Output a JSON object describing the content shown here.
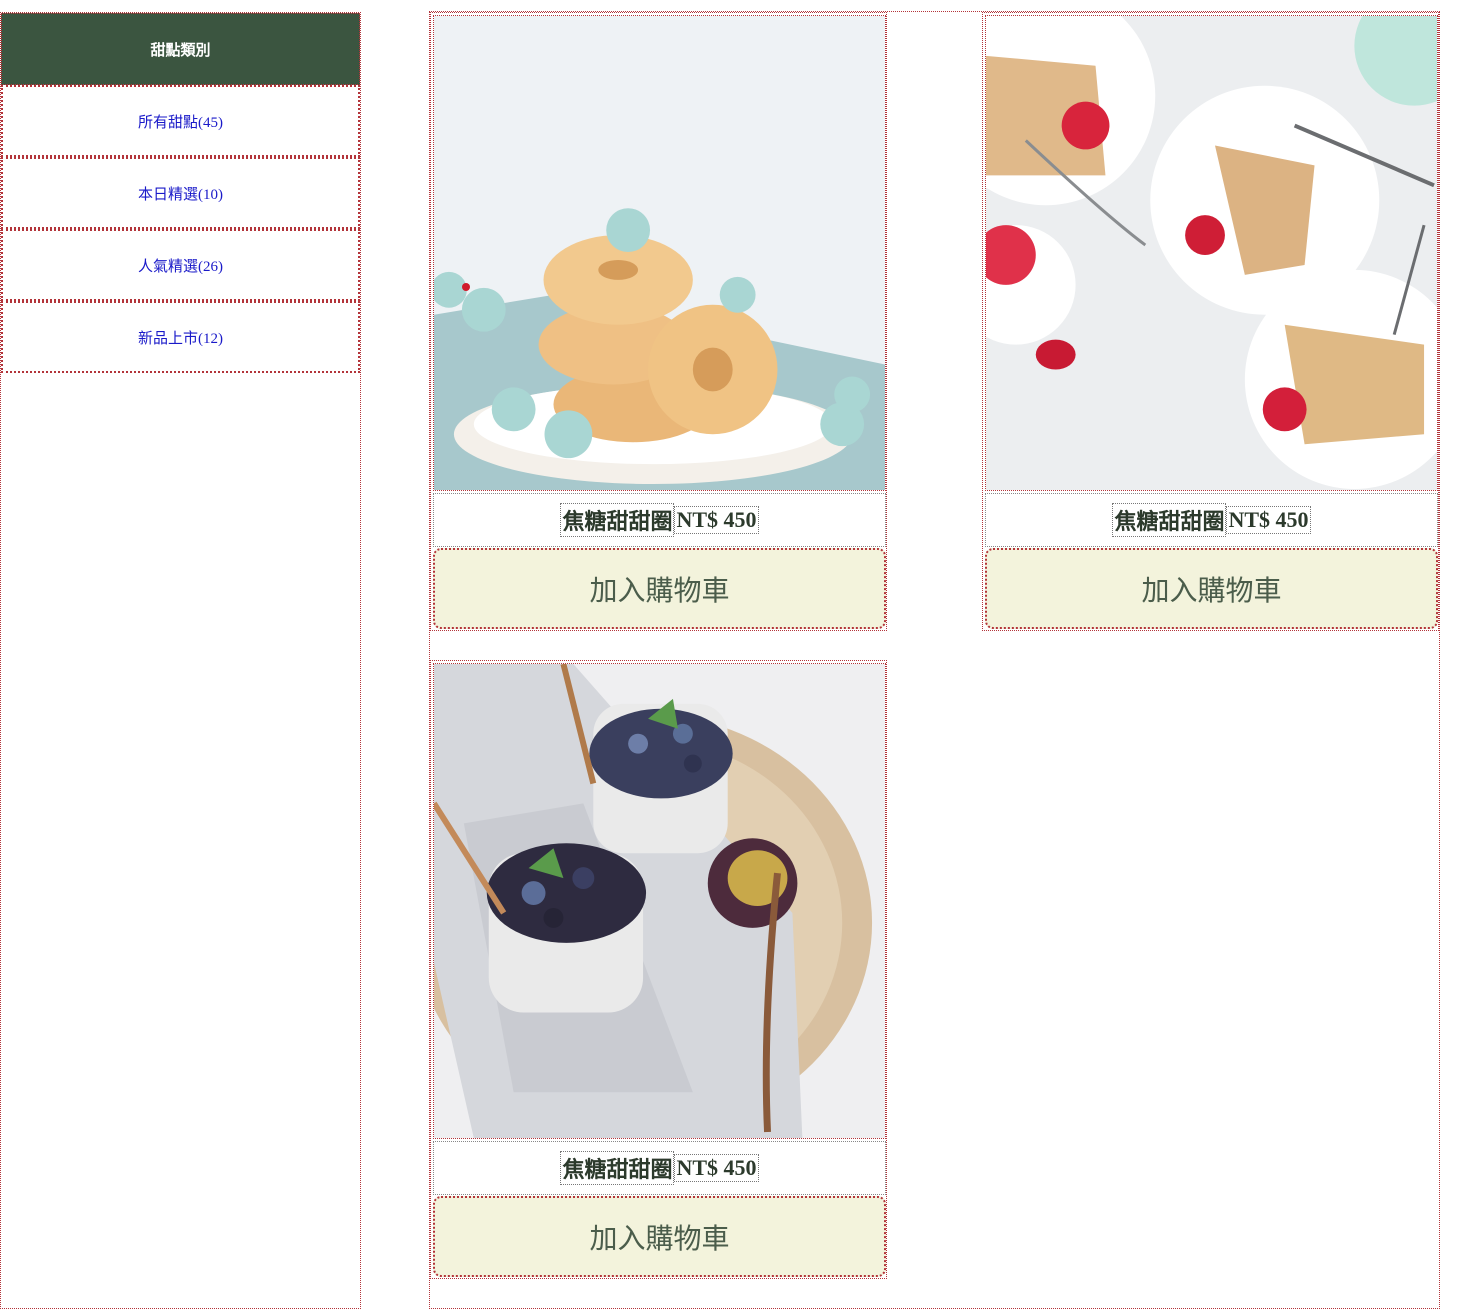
{
  "sidebar": {
    "header": "甜點類別",
    "items": [
      {
        "label": "所有甜點(45)"
      },
      {
        "label": "本日精選(10)"
      },
      {
        "label": "人氣精選(26)"
      },
      {
        "label": "新品上市(12)"
      }
    ]
  },
  "products": [
    {
      "name": "焦糖甜甜圈",
      "price": "NT$ 450",
      "button": "加入購物車",
      "image_icon": "donut-stack-photo"
    },
    {
      "name": "焦糖甜甜圈",
      "price": "NT$ 450",
      "button": "加入購物車",
      "image_icon": "berry-cake-photo"
    },
    {
      "name": "焦糖甜甜圈",
      "price": "NT$ 450",
      "button": "加入購物車",
      "image_icon": "berry-parfait-photo"
    }
  ],
  "colors": {
    "sidebar_header_bg": "#3b5540",
    "link": "#1a1ac9",
    "button_bg": "#f3f3dc",
    "border": "#b3343a",
    "price_text": "#2c3a2c"
  }
}
